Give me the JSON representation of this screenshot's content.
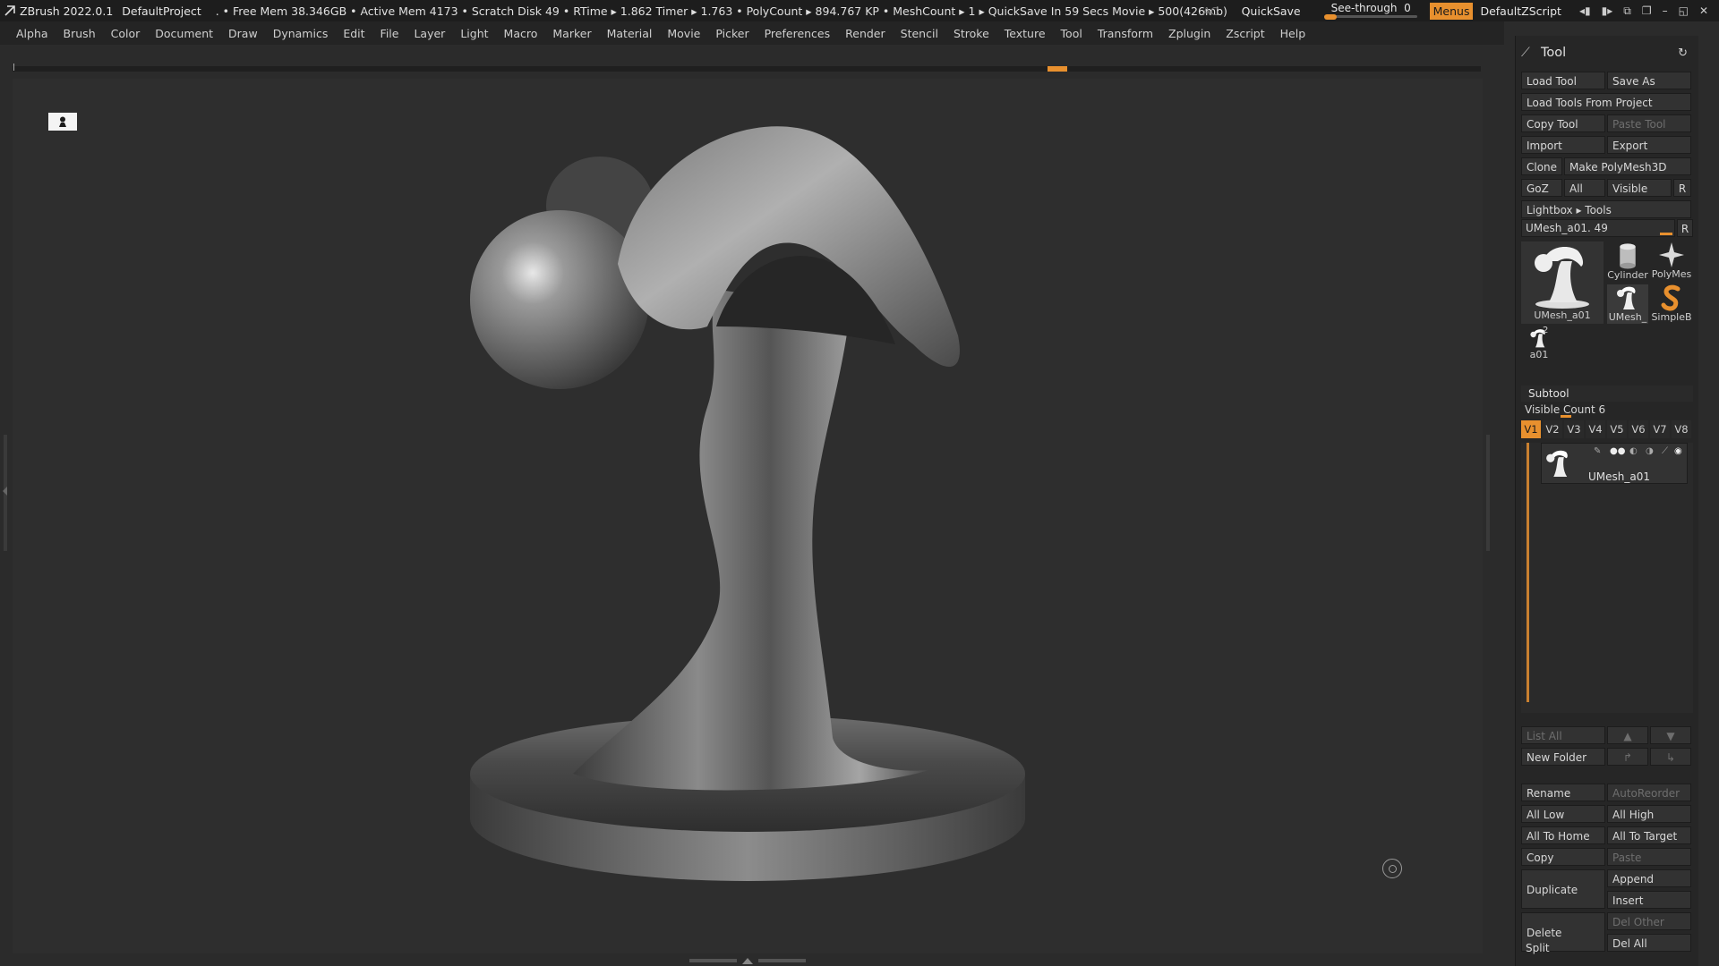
{
  "topbar": {
    "app": "ZBrush 2022.0.1",
    "project": "DefaultProject",
    "stats": ". • Free Mem 38.346GB • Active Mem 4173 • Scratch Disk 49 •  RTime ▸ 1.862 Timer ▸ 1.763 • PolyCount ▸ 894.767 KP  • MeshCount ▸ 1  ▸ QuickSave In 59 Secs Movie ▸ 500(426mb)",
    "ac": "AC",
    "quicksave": "QuickSave",
    "see_through_label": "See-through",
    "see_through_value": "0",
    "see_through_fraction": 0,
    "menus": "Menus",
    "zscript": "DefaultZScript",
    "accent": "#e8902e"
  },
  "menubar": [
    "Alpha",
    "Brush",
    "Color",
    "Document",
    "Draw",
    "Dynamics",
    "Edit",
    "File",
    "Layer",
    "Light",
    "Macro",
    "Marker",
    "Material",
    "Movie",
    "Picker",
    "Preferences",
    "Render",
    "Stencil",
    "Stroke",
    "Texture",
    "Tool",
    "Transform",
    "Zplugin",
    "Zscript",
    "Help"
  ],
  "panel": {
    "title": "Tool",
    "load_tool": "Load Tool",
    "save_as": "Save As",
    "load_from_project": "Load Tools From Project",
    "copy_tool": "Copy Tool",
    "paste_tool": "Paste Tool",
    "import": "Import",
    "export": "Export",
    "clone": "Clone",
    "make_polymesh": "Make PolyMesh3D",
    "goz": "GoZ",
    "all": "All",
    "visible": "Visible",
    "r": "R",
    "lightbox": "Lightbox ▸ Tools",
    "current_tool": "UMesh_a01. 49",
    "thumbs": {
      "main": "UMesh_a01",
      "cylinder": "Cylinder",
      "polymesh": "PolyMes",
      "umesh": "UMesh_",
      "simpleb": "SimpleB",
      "a01": "a01",
      "a01_count": "2"
    },
    "subtool": {
      "title": "Subtool",
      "visible_count": "Visible Count 6",
      "visible_fraction": 0.06,
      "vtabs": [
        "V1",
        "V2",
        "V3",
        "V4",
        "V5",
        "V6",
        "V7",
        "V8"
      ],
      "item_name": "UMesh_a01"
    },
    "list_all": "List All",
    "new_folder": "New Folder",
    "rename": "Rename",
    "auto_reorder": "AutoReorder",
    "all_low": "All Low",
    "all_high": "All High",
    "all_to_home": "All To Home",
    "all_to_target": "All To Target",
    "copy": "Copy",
    "paste": "Paste",
    "duplicate": "Duplicate",
    "append": "Append",
    "insert": "Insert",
    "delete": "Delete",
    "del_other": "Del Other",
    "del_all": "Del All",
    "split": "Split"
  },
  "icons": [
    "zbrush-logo-icon",
    "floor-icon",
    "gizmo-icon",
    "pin-icon",
    "reset-icon",
    "eye-icon",
    "arrow-up-icon",
    "arrow-down-icon",
    "folder-icon"
  ]
}
